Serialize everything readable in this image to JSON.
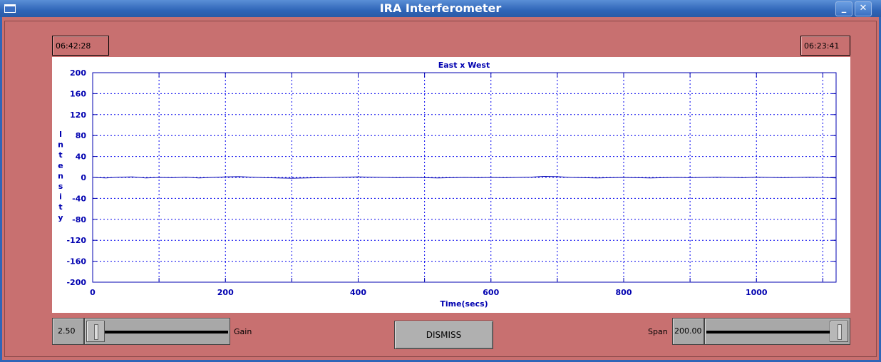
{
  "window": {
    "title": "IRA Interferometer",
    "minimize_label": "_",
    "close_label": "✕"
  },
  "clocks": {
    "left": "06:42:28",
    "right": "06:23:41"
  },
  "controls": {
    "gain_value": "2.50",
    "gain_label": "Gain",
    "gain_level": 0.0,
    "span_label": "Span",
    "span_value": "200.00",
    "span_level": 1.0,
    "dismiss_label": "DISMISS"
  },
  "colors": {
    "background": "#c87070",
    "plot_color": "#0000b0",
    "grid_color": "#0000ee"
  },
  "chart_data": {
    "type": "line",
    "title": "East x West",
    "xlabel": "Time(secs)",
    "ylabel": "Intensity",
    "xlim": [
      0,
      1120
    ],
    "ylim": [
      -200,
      200
    ],
    "x_ticks": [
      "0",
      "200",
      "400",
      "600",
      "800",
      "1000"
    ],
    "x_tick_values": [
      0,
      200,
      400,
      600,
      800,
      1000
    ],
    "x_grid_values": [
      0,
      100,
      200,
      300,
      400,
      500,
      600,
      700,
      800,
      900,
      1000,
      1100
    ],
    "y_ticks": [
      "200",
      "160",
      "120",
      "80",
      "40",
      "0",
      "-40",
      "-80",
      "-120",
      "-160",
      "-200"
    ],
    "y_tick_values": [
      200,
      160,
      120,
      80,
      40,
      0,
      -40,
      -80,
      -120,
      -160,
      -200
    ],
    "grid": true,
    "series": [
      {
        "x": [
          0,
          20,
          40,
          60,
          80,
          100,
          120,
          140,
          160,
          180,
          200,
          220,
          240,
          260,
          280,
          300,
          320,
          340,
          360,
          380,
          400,
          420,
          440,
          460,
          480,
          500,
          520,
          540,
          560,
          580,
          600,
          620,
          640,
          660,
          680,
          700,
          720,
          740,
          760,
          780,
          800,
          820,
          840,
          860,
          880,
          900,
          920,
          940,
          960,
          980,
          1000,
          1020,
          1040,
          1060,
          1080,
          1100,
          1120
        ],
        "values": [
          0,
          -1,
          0.5,
          1,
          -1,
          0,
          -0.5,
          0.5,
          -1,
          0,
          1,
          1.5,
          0.5,
          -0.5,
          -1,
          -1.5,
          -1,
          -0.5,
          0,
          0.5,
          1,
          0.5,
          0,
          -0.5,
          0,
          -0.5,
          -1,
          -0.5,
          0,
          -0.5,
          0,
          -0.5,
          0,
          0.5,
          2,
          1.5,
          0,
          -0.5,
          -1,
          -0.5,
          0,
          -0.5,
          -1,
          -0.5,
          0,
          -0.5,
          0,
          0.5,
          0,
          -0.5,
          0.5,
          0,
          -0.5,
          0,
          0.5,
          0,
          -1
        ]
      }
    ]
  }
}
